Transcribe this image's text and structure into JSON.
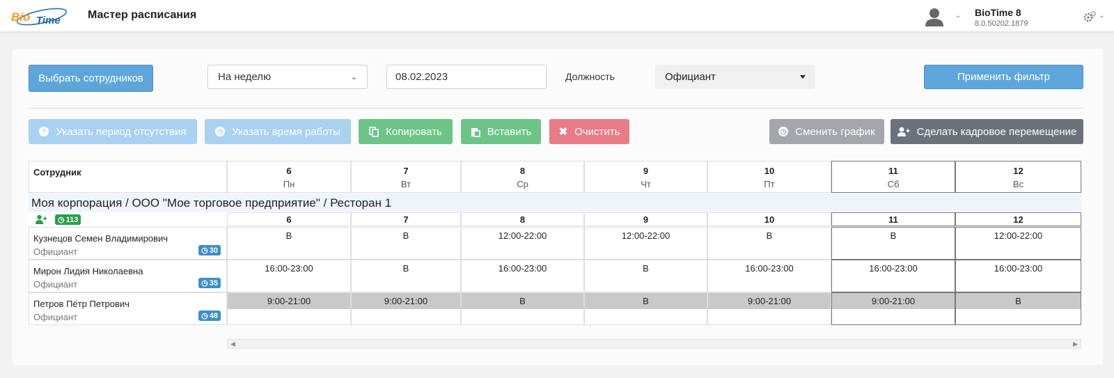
{
  "header": {
    "logo_text": "BioTime",
    "title": "Мастер расписания",
    "app_name": "BioTime 8",
    "app_version": "8.0.50202.1879"
  },
  "filters": {
    "select_employees": "Выбрать сотрудников",
    "period": "На неделю",
    "date": "08.02.2023",
    "position_label": "Должность",
    "position": "Официант",
    "apply": "Применить фильтр"
  },
  "actions": {
    "absence": "Указать период отсутствия",
    "worktime": "Указать время работы",
    "copy": "Копировать",
    "paste": "Вставить",
    "clear": "Очистить",
    "change_schedule": "Сменить график",
    "transfer": "Сделать кадровое перемещение"
  },
  "table": {
    "employee_header": "Сотрудник",
    "days": [
      {
        "num": "6",
        "name": "Пн"
      },
      {
        "num": "7",
        "name": "Вт"
      },
      {
        "num": "8",
        "name": "Ср"
      },
      {
        "num": "9",
        "name": "Чт"
      },
      {
        "num": "10",
        "name": "Пт"
      },
      {
        "num": "11",
        "name": "Сб"
      },
      {
        "num": "12",
        "name": "Вс"
      }
    ],
    "group": {
      "title": "Моя корпорация / ООО \"Мое торговое предприятие\" / Ресторан 1",
      "badge": "113"
    },
    "employees": [
      {
        "name": "Кузнецов Семен Владимирович",
        "position": "Официант",
        "badge": "30",
        "cells": [
          "В",
          "В",
          "12:00-22:00",
          "12:00-22:00",
          "В",
          "В",
          "12:00-22:00"
        ]
      },
      {
        "name": "Мирон Лидия Николаевна",
        "position": "Официант",
        "badge": "35",
        "cells": [
          "16:00-23:00",
          "В",
          "16:00-23:00",
          "В",
          "16:00-23:00",
          "16:00-23:00",
          "16:00-23:00"
        ]
      },
      {
        "name": "Петров Пётр Петрович",
        "position": "Официант",
        "badge": "48",
        "cells": [
          "9:00-21:00",
          "9:00-21:00",
          "В",
          "В",
          "9:00-21:00",
          "9:00-21:00",
          "В"
        ]
      }
    ]
  },
  "colors": {
    "primary": "#5ea6d9",
    "success": "#6cc487",
    "danger": "#e97b86",
    "gray": "#a3a6aa",
    "dark": "#6b7279"
  }
}
